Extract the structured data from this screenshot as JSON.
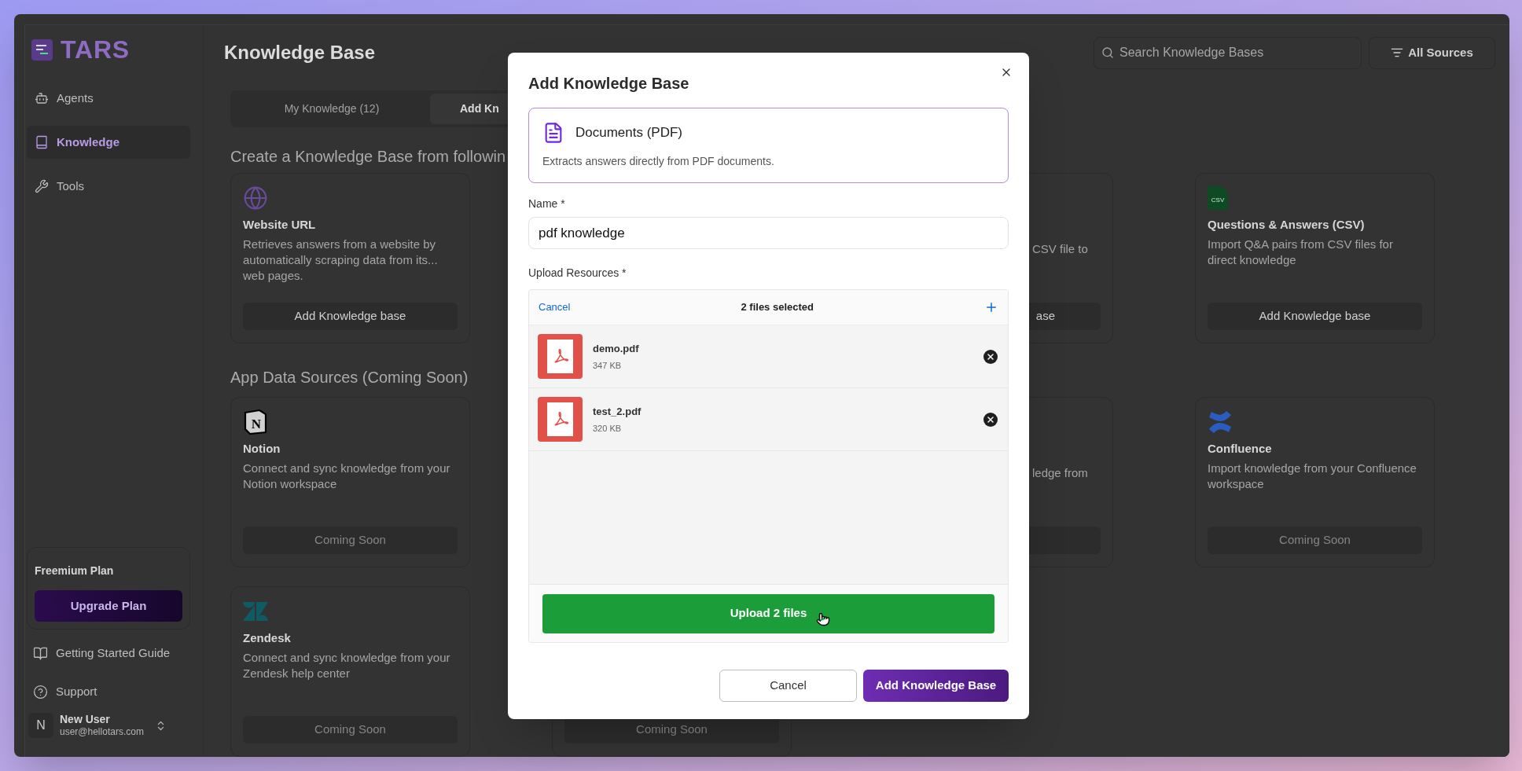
{
  "app": {
    "logo": "TARS"
  },
  "sidebar": {
    "items": [
      {
        "label": "Agents",
        "selected": false
      },
      {
        "label": "Knowledge",
        "selected": true
      },
      {
        "label": "Tools",
        "selected": false
      }
    ],
    "plan": {
      "title": "Freemium Plan",
      "button": "Upgrade Plan"
    },
    "links": [
      {
        "label": "Getting Started Guide"
      },
      {
        "label": "Support"
      }
    ],
    "user": {
      "initial": "N",
      "name": "New User",
      "email": "user@hellotars.com"
    }
  },
  "header": {
    "title": "Knowledge Base",
    "search": {
      "placeholder": "Search Knowledge Bases"
    },
    "filter": "All Sources"
  },
  "tabs": [
    {
      "label": "My Knowledge (12)",
      "selected": false
    },
    {
      "label": "Add Kn",
      "selected": true
    }
  ],
  "sections": [
    {
      "heading": "Create a Knowledge Base from followin",
      "cards": [
        {
          "kind": "website",
          "title": "Website URL",
          "description": "Retrieves answers from a website by automatically scraping data from its... web pages.",
          "button": "Add Knowledge base",
          "disabled": false
        },
        {
          "kind": "partial",
          "description": "CSV file to",
          "button": "ase",
          "disabled": false
        },
        {
          "kind": "csv",
          "icon_text": "CSV",
          "title": "Questions & Answers (CSV)",
          "description": "Import Q&A pairs from CSV files for direct knowledge",
          "button": "Add Knowledge base",
          "disabled": false
        }
      ]
    },
    {
      "heading": "App Data Sources (Coming Soon)",
      "cards": [
        {
          "kind": "notion",
          "icon_text": "N",
          "title": "Notion",
          "description": "Connect and sync knowledge from your Notion workspace",
          "button": "Coming Soon",
          "disabled": true
        },
        {
          "kind": "partial",
          "description": "ledge from"
        },
        {
          "kind": "confluence",
          "title": "Confluence",
          "description": "Import knowledge from your Confluence workspace",
          "button": "Coming Soon",
          "disabled": true
        },
        {
          "kind": "zendesk",
          "title": "Zendesk",
          "description": "Connect and sync knowledge from your Zendesk help center",
          "button": "Coming Soon",
          "disabled": true
        },
        {
          "kind": "partial",
          "button": "Coming Soon",
          "disabled": true
        }
      ]
    }
  ],
  "modal": {
    "title": "Add Knowledge Base",
    "source": {
      "title": "Documents (PDF)",
      "description": "Extracts answers directly from PDF documents."
    },
    "name_label": "Name *",
    "name_value": "pdf knowledge",
    "upload_label": "Upload Resources *",
    "uploader": {
      "cancel": "Cancel",
      "status": "2 files selected",
      "files": [
        {
          "name": "demo.pdf",
          "size": "347 KB"
        },
        {
          "name": "test_2.pdf",
          "size": "320 KB"
        }
      ],
      "upload_button": "Upload 2 files"
    },
    "buttons": [
      {
        "label": "Cancel",
        "kind": "secondary"
      },
      {
        "label": "Add Knowledge Base",
        "kind": "primary"
      }
    ]
  }
}
